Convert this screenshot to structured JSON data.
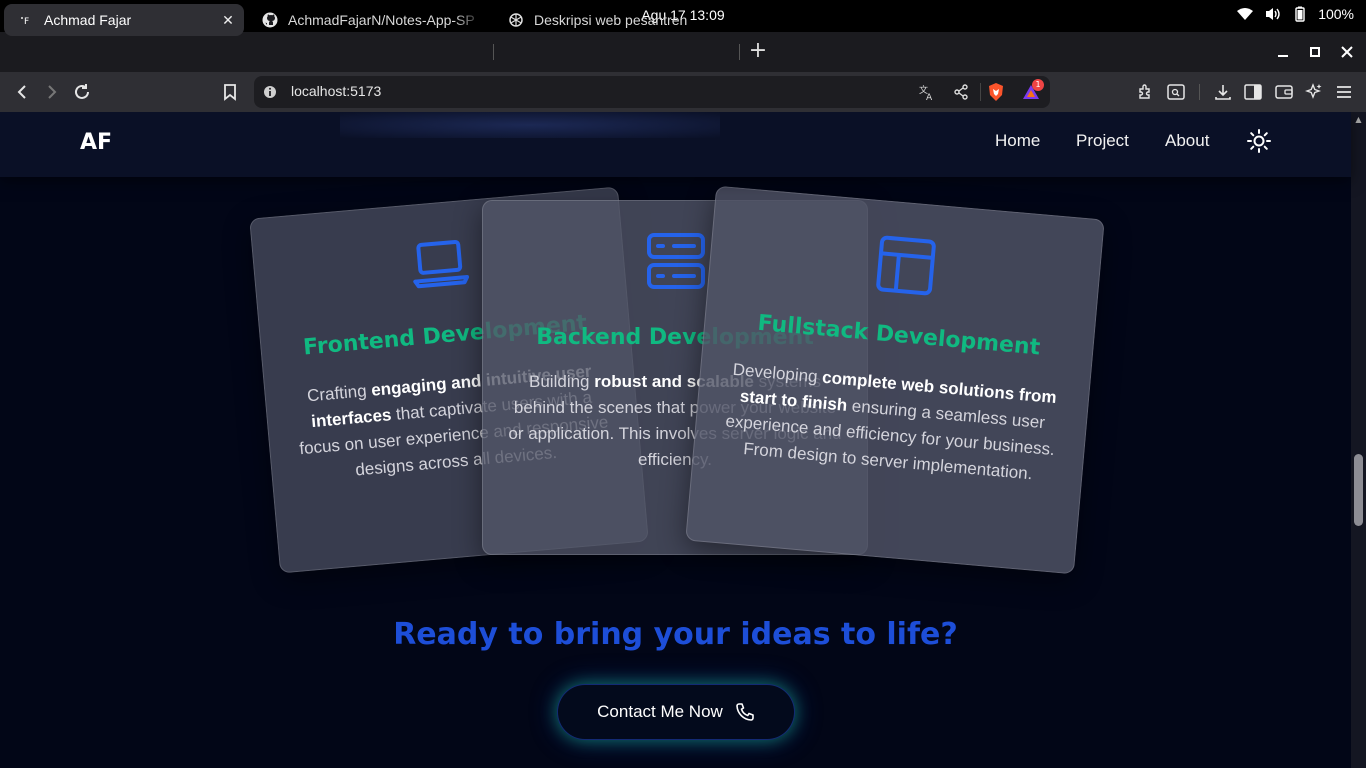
{
  "os": {
    "clock": "Agu 17  13:09",
    "battery": "100%"
  },
  "tabs": [
    {
      "title": "Achmad Fajar",
      "favicon": "site-favicon"
    },
    {
      "title": "AchmadFajarN/Notes-App-SP",
      "favicon": "github-icon"
    },
    {
      "title": "Deskripsi web pesantren",
      "favicon": "chatgpt-icon"
    }
  ],
  "omnibox": {
    "url": "localhost:5173",
    "notification_count": "1"
  },
  "page": {
    "brand": "AF",
    "nav": {
      "home": "Home",
      "project": "Project",
      "about": "About"
    },
    "cards": [
      {
        "icon": "laptop-icon",
        "title": "Frontend Development",
        "desc_before": "Crafting ",
        "desc_bold": "engaging and intuitive user interfaces",
        "desc_after": " that captivate users with a focus on user experience and responsive designs across all devices."
      },
      {
        "icon": "server-icon",
        "title": "Backend Development",
        "desc_before": "Building ",
        "desc_bold": "robust and scalable",
        "desc_after": " systems behind the scenes that power your website or application. This involves server logic and efficiency."
      },
      {
        "icon": "layout-icon",
        "title": "Fullstack Development",
        "desc_before": "Developing ",
        "desc_bold": "complete web solutions from start to finish",
        "desc_after": " ensuring a seamless user experience and efficiency for your business. From design to server implementation."
      }
    ],
    "cta": {
      "heading": "Ready to bring your ideas to life?",
      "button": "Contact Me Now"
    }
  },
  "colors": {
    "accent_green": "#10b981",
    "accent_blue": "#2563eb",
    "page_bg": "#020617"
  }
}
